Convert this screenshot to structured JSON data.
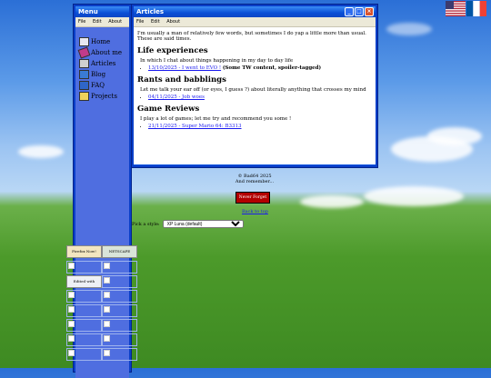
{
  "menu_window": {
    "title": "Menu",
    "menubar": [
      "File",
      "Edit",
      "About"
    ],
    "items": [
      {
        "label": "Home",
        "icon": "home-icon"
      },
      {
        "label": "About me",
        "icon": "about-icon"
      },
      {
        "label": "Articles",
        "icon": "articles-icon"
      },
      {
        "label": "Blog",
        "icon": "blog-icon"
      },
      {
        "label": "FAQ",
        "icon": "faq-icon"
      },
      {
        "label": "Projects",
        "icon": "projects-icon"
      }
    ]
  },
  "articles_window": {
    "title": "Articles",
    "menubar": [
      "File",
      "Edit",
      "About"
    ],
    "intro": "I'm usually a man of relatively few words, but sometimes I do yap a little more than usual. These are said times.",
    "sections": [
      {
        "heading": "Life experiences",
        "description": "In which I chat about things happening in my day to day life",
        "link": "13/10/2025 - I went to EVO !",
        "note": "(Some TW content, spoiler-tagged)"
      },
      {
        "heading": "Rants and babblings",
        "description": "Let me talk your ear off (or eyes, I guess ?) about literally anything that crosses my mind",
        "link": "04/11/2025 - Job woes",
        "note": ""
      },
      {
        "heading": "Game Reviews",
        "description": "I play a lot of games; let me try and recommend you some !",
        "link": "21/11/2025 - Super Mario 64: B3313",
        "note": ""
      }
    ]
  },
  "footer": {
    "copyright": "© Bad64 2025",
    "remember": "And remember...",
    "badge": "Never Forget",
    "back_to_top": "Back to top",
    "style_label": "Pick a style:",
    "style_selected": "XP Luna (default)"
  },
  "buttons": {
    "firefox": "Firefox Now!",
    "netscape": "NETSCAPE NOW!",
    "notepad": "Edited with Notepad"
  },
  "colors": {
    "titlebar": "#0a4fd6",
    "menu_body": "#4f6ee0",
    "link": "#1a1aee"
  }
}
